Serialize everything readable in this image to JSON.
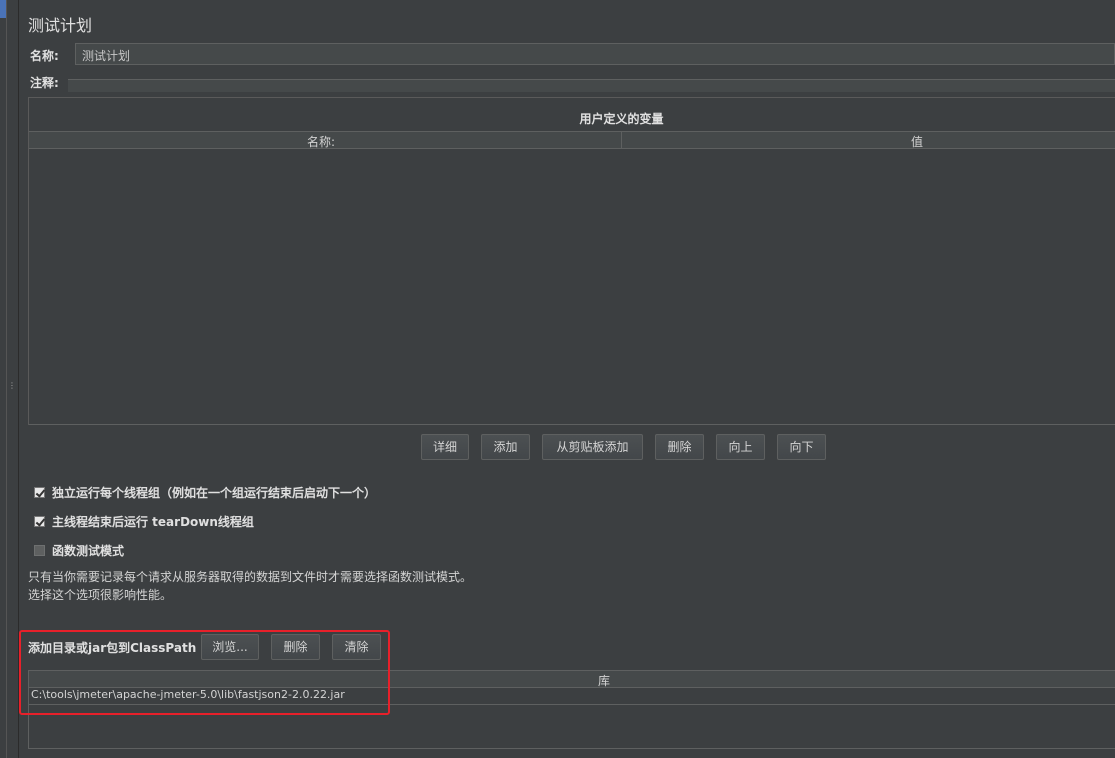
{
  "panel": {
    "title": "测试计划",
    "name_label": "名称:",
    "name_value": "测试计划",
    "comment_label": "注释:"
  },
  "variables": {
    "title": "用户定义的变量",
    "columns": [
      "名称:",
      "值"
    ]
  },
  "buttons": {
    "detail": "详细",
    "add": "添加",
    "add_from_clipboard": "从剪贴板添加",
    "delete": "删除",
    "up": "向上",
    "down": "向下"
  },
  "options": [
    {
      "label": "独立运行每个线程组（例如在一个组运行结束后启动下一个）",
      "checked": true
    },
    {
      "label": "主线程结束后运行 tearDown线程组",
      "checked": true
    },
    {
      "label": "函数测试模式",
      "checked": false
    }
  ],
  "notes": [
    "只有当你需要记录每个请求从服务器取得的数据到文件时才需要选择函数测试模式。",
    "选择这个选项很影响性能。"
  ],
  "classpath": {
    "label": "添加目录或jar包到ClassPath",
    "browse": "浏览...",
    "delete": "删除",
    "clear": "清除",
    "column": "库",
    "rows": [
      "C:\\tools\\jmeter\\apache-jmeter-5.0\\lib\\fastjson2-2.0.22.jar"
    ]
  },
  "colors": {
    "background": "#3c3f41",
    "highlight": "#e8202a"
  }
}
